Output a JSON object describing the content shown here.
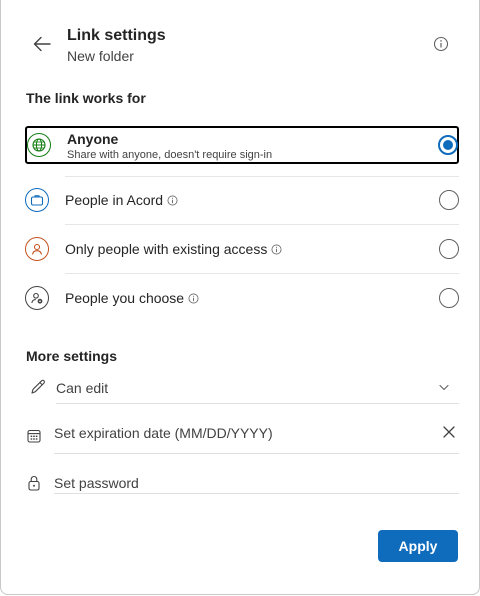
{
  "header": {
    "title": "Link settings",
    "subtitle": "New folder"
  },
  "link_works_for": {
    "heading": "The link works for",
    "options": [
      {
        "label": "Anyone",
        "sublabel": "Share with anyone, doesn't require sign-in",
        "icon": "globe-icon",
        "selected": true
      },
      {
        "label": "People in Acord",
        "icon": "briefcase-icon",
        "selected": false,
        "has_info": true
      },
      {
        "label": "Only people with existing access",
        "icon": "person-icon",
        "selected": false,
        "has_info": true
      },
      {
        "label": "People you choose",
        "icon": "person-settings-icon",
        "selected": false,
        "has_info": true
      }
    ]
  },
  "more_settings": {
    "heading": "More settings",
    "permission": {
      "value": "Can edit",
      "icon": "pencil-icon"
    },
    "expiration": {
      "placeholder": "Set expiration date (MM/DD/YYYY)",
      "icon": "calendar-icon"
    },
    "password": {
      "placeholder": "Set password",
      "icon": "lock-icon"
    }
  },
  "footer": {
    "apply_label": "Apply"
  },
  "colors": {
    "accent": "#0f6cbd",
    "globe": "#107c10",
    "briefcase": "#0f6cbd",
    "person": "#c4521e"
  }
}
